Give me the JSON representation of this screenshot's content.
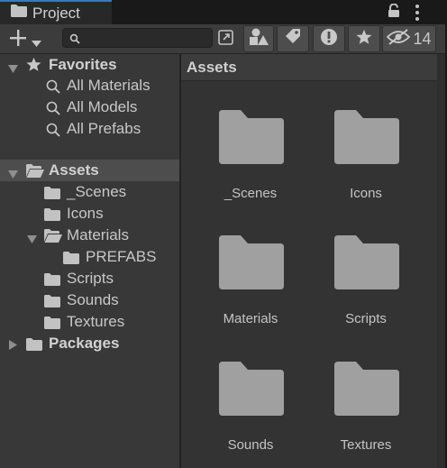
{
  "window": {
    "tab_title": "Project"
  },
  "toolbar": {
    "search": {
      "value": "",
      "placeholder": ""
    },
    "hidden_count": "14"
  },
  "tree": {
    "favorites": {
      "label": "Favorites",
      "items": [
        {
          "label": "All Materials"
        },
        {
          "label": "All Models"
        },
        {
          "label": "All Prefabs"
        }
      ]
    },
    "assets": {
      "label": "Assets",
      "items": [
        {
          "label": "_Scenes"
        },
        {
          "label": "Icons"
        },
        {
          "label": "Materials"
        },
        {
          "label": "PREFABS"
        },
        {
          "label": "Scripts"
        },
        {
          "label": "Sounds"
        },
        {
          "label": "Textures"
        }
      ]
    },
    "packages": {
      "label": "Packages"
    }
  },
  "grid": {
    "title": "Assets",
    "items": [
      {
        "label": "_Scenes"
      },
      {
        "label": "Icons"
      },
      {
        "label": "Materials"
      },
      {
        "label": "Scripts"
      },
      {
        "label": "Sounds"
      },
      {
        "label": "Textures"
      }
    ]
  },
  "colors": {
    "tab_accent": "#3a79bb",
    "panel_bg": "#383838",
    "grid_bg": "#333333",
    "folder_large": "#a0a0a0",
    "folder_small": "#c2c2c2"
  }
}
